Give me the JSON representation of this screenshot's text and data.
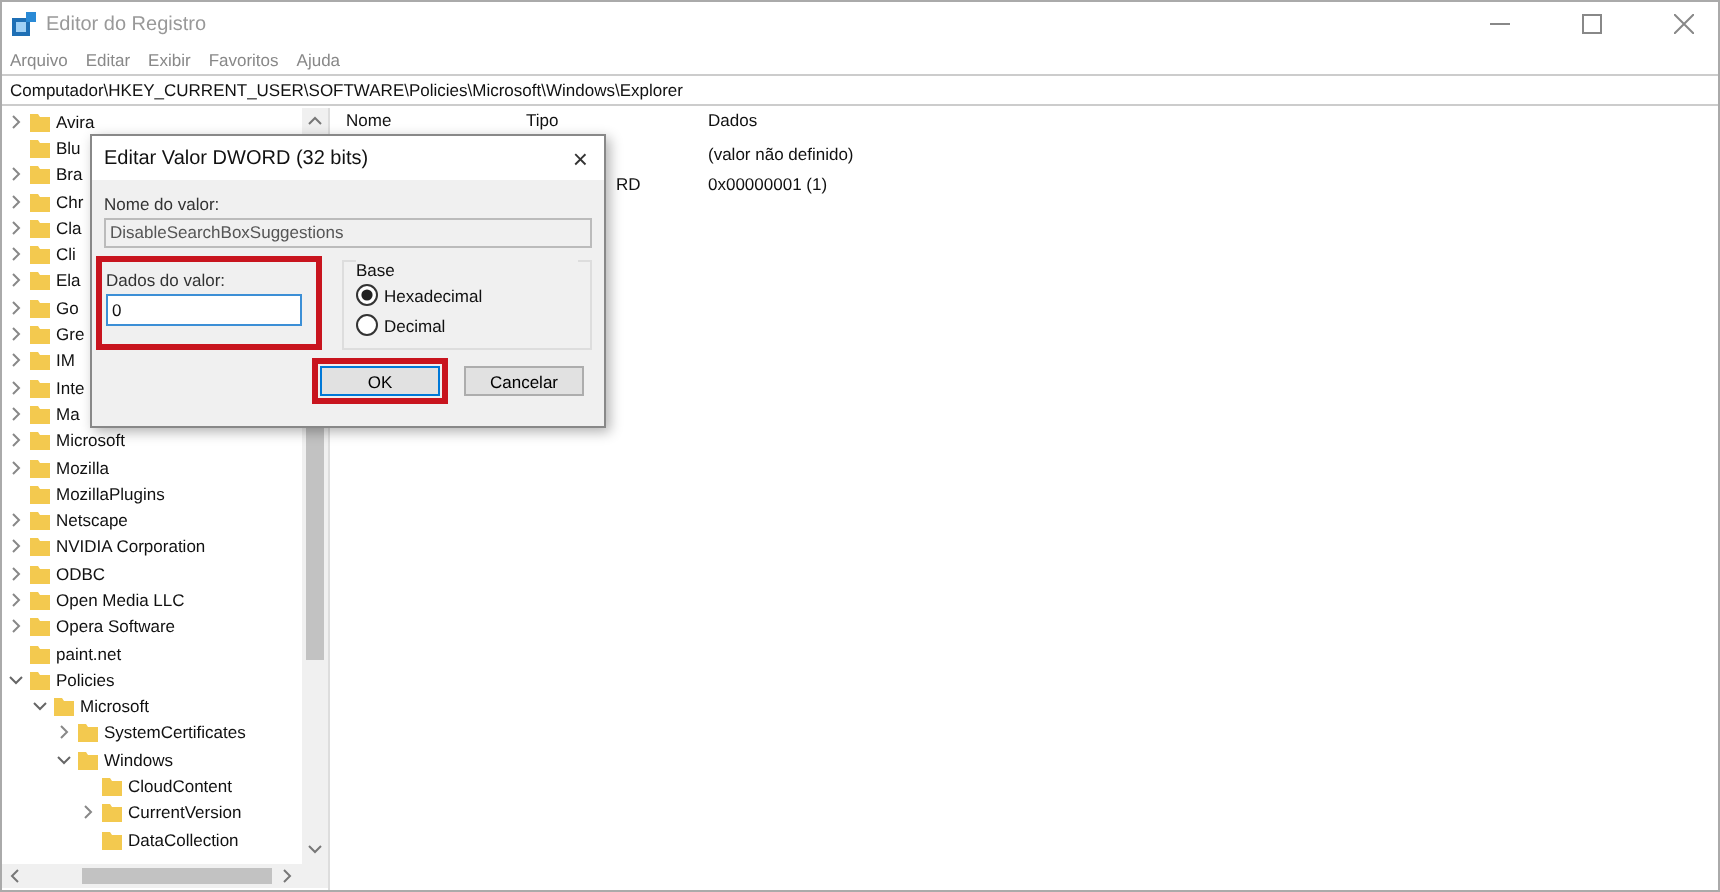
{
  "window": {
    "title": "Editor do Registro"
  },
  "menu": [
    "Arquivo",
    "Editar",
    "Exibir",
    "Favoritos",
    "Ajuda"
  ],
  "address": "Computador\\HKEY_CURRENT_USER\\SOFTWARE\\Policies\\Microsoft\\Windows\\Explorer",
  "tree": [
    {
      "label": "Avira",
      "expandable": true,
      "expanded": false
    },
    {
      "label": "Blu",
      "expandable": false,
      "expanded": false
    },
    {
      "label": "Bra",
      "expandable": true,
      "expanded": false
    },
    {
      "label": "Chr",
      "expandable": true,
      "expanded": false
    },
    {
      "label": "Cla",
      "expandable": true,
      "expanded": false
    },
    {
      "label": "Cli",
      "expandable": true,
      "expanded": false
    },
    {
      "label": "Ela",
      "expandable": true,
      "expanded": false
    },
    {
      "label": "Go",
      "expandable": true,
      "expanded": false
    },
    {
      "label": "Gre",
      "expandable": true,
      "expanded": false
    },
    {
      "label": "IM",
      "expandable": true,
      "expanded": false
    },
    {
      "label": "Inte",
      "expandable": true,
      "expanded": false
    },
    {
      "label": "Ma",
      "expandable": true,
      "expanded": false
    },
    {
      "label": "Microsoft",
      "expandable": true,
      "expanded": false
    },
    {
      "label": "Mozilla",
      "expandable": true,
      "expanded": false
    },
    {
      "label": "MozillaPlugins",
      "expandable": false,
      "expanded": false
    },
    {
      "label": "Netscape",
      "expandable": true,
      "expanded": false
    },
    {
      "label": "NVIDIA Corporation",
      "expandable": true,
      "expanded": false
    },
    {
      "label": "ODBC",
      "expandable": true,
      "expanded": false
    },
    {
      "label": "Open Media LLC",
      "expandable": true,
      "expanded": false
    },
    {
      "label": "Opera Software",
      "expandable": true,
      "expanded": false
    },
    {
      "label": "paint.net",
      "expandable": false,
      "expanded": false
    },
    {
      "label": "Policies",
      "expanded": true,
      "children": [
        {
          "label": "Microsoft",
          "expanded": true,
          "children": [
            {
              "label": "SystemCertificates",
              "expandable": true,
              "expanded": false
            },
            {
              "label": "Windows",
              "expanded": true,
              "children": [
                {
                  "label": "CloudContent",
                  "expandable": false,
                  "expanded": false
                },
                {
                  "label": "CurrentVersion",
                  "expandable": true,
                  "expanded": false
                },
                {
                  "label": "DataCollection",
                  "expandable": false,
                  "expanded": false
                }
              ]
            }
          ]
        }
      ]
    }
  ],
  "list": {
    "columns": [
      "Nome",
      "Tipo",
      "Dados"
    ],
    "rows": [
      {
        "data": "(valor não definido)"
      },
      {
        "type": "RD",
        "data": "0x00000001 (1)"
      }
    ]
  },
  "dialog": {
    "title": "Editar Valor DWORD (32 bits)",
    "close": "×",
    "name_label": "Nome do valor:",
    "name_value": "DisableSearchBoxSuggestions",
    "data_label": "Dados do valor:",
    "data_value": "0",
    "data_highlighted": true,
    "base_label": "Base",
    "radios": [
      {
        "label": "Hexadecimal",
        "selected": true
      },
      {
        "label": "Decimal",
        "selected": false
      }
    ],
    "buttons": [
      {
        "label": "OK",
        "highlighted": true
      },
      {
        "label": "Cancelar",
        "highlighted": false
      }
    ]
  }
}
